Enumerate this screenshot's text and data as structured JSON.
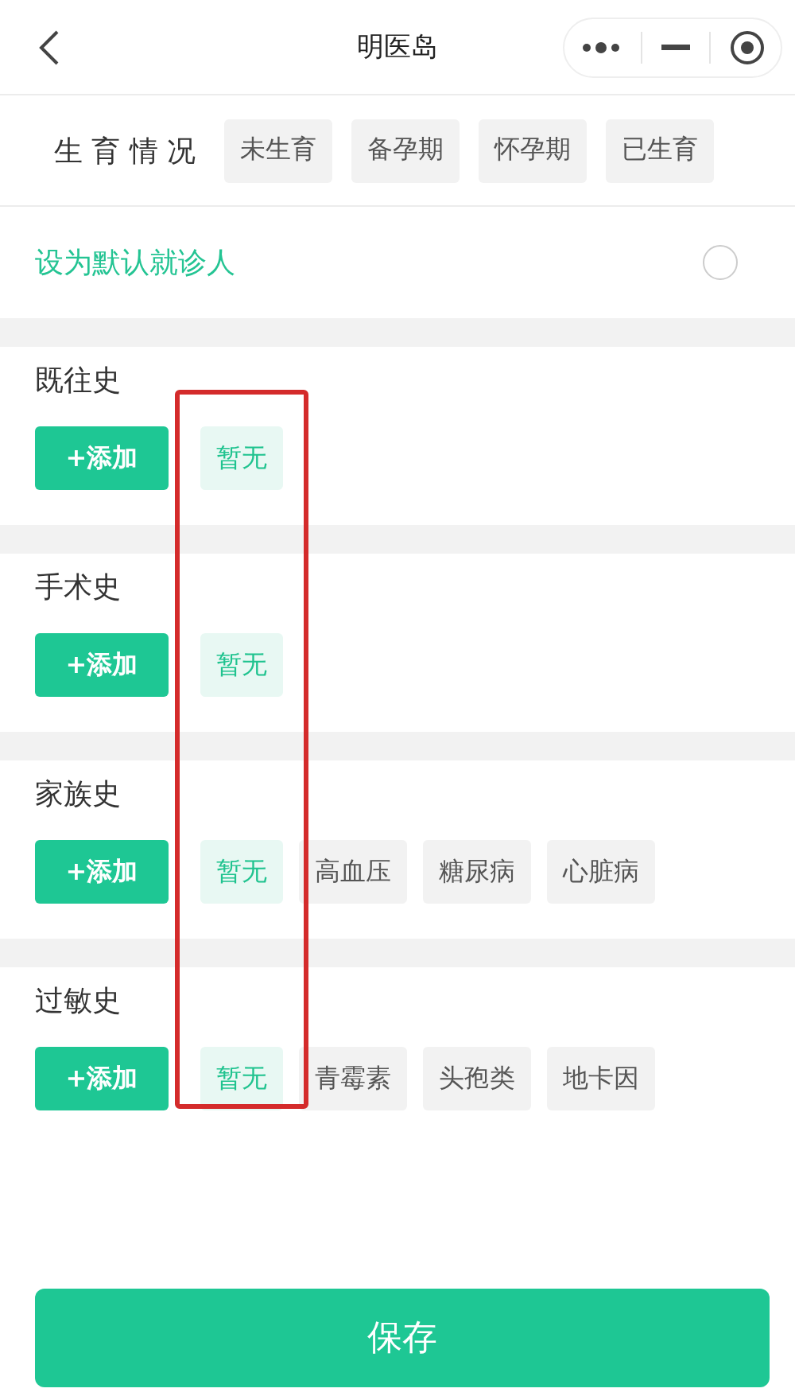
{
  "nav": {
    "title": "明医岛"
  },
  "fertility": {
    "label": "生 育 情 况",
    "options": [
      {
        "label": "未生育",
        "selected": false
      },
      {
        "label": "备孕期",
        "selected": false
      },
      {
        "label": "怀孕期",
        "selected": false
      },
      {
        "label": "已生育",
        "selected": false
      }
    ]
  },
  "default_patient": {
    "label": "设为默认就诊人",
    "checked": false
  },
  "histories": [
    {
      "title": "既往史",
      "add_button": "+添加",
      "tags": [
        {
          "label": "暂无",
          "selected": true
        }
      ]
    },
    {
      "title": "手术史",
      "add_button": "+添加",
      "tags": [
        {
          "label": "暂无",
          "selected": true
        }
      ]
    },
    {
      "title": "家族史",
      "add_button": "+添加",
      "tags": [
        {
          "label": "暂无",
          "selected": true
        },
        {
          "label": "高血压",
          "selected": false
        },
        {
          "label": "糖尿病",
          "selected": false
        },
        {
          "label": "心脏病",
          "selected": false
        }
      ]
    },
    {
      "title": "过敏史",
      "add_button": "+添加",
      "tags": [
        {
          "label": "暂无",
          "selected": true
        },
        {
          "label": "青霉素",
          "selected": false
        },
        {
          "label": "头孢类",
          "selected": false
        },
        {
          "label": "地卡因",
          "selected": false
        }
      ]
    }
  ],
  "save_button": "保存"
}
